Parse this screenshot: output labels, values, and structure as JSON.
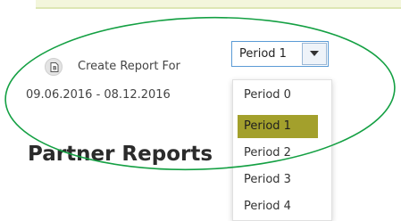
{
  "report_panel": {
    "create_label": "Create Report For",
    "date_range": "09.06.2016 - 08.12.2016",
    "icon": "report-icon"
  },
  "period_select": {
    "selected_value": "Period 1",
    "arrow_icon": "chevron-down-icon",
    "options": [
      {
        "label": "Period 0"
      },
      {
        "label": "Period 1"
      },
      {
        "label": "Period 2"
      },
      {
        "label": "Period 3"
      },
      {
        "label": "Period 4"
      }
    ],
    "highlight_color": "#a3a02c"
  },
  "section": {
    "title": "Partner Reports"
  },
  "annotation": {
    "color": "#14a043"
  }
}
